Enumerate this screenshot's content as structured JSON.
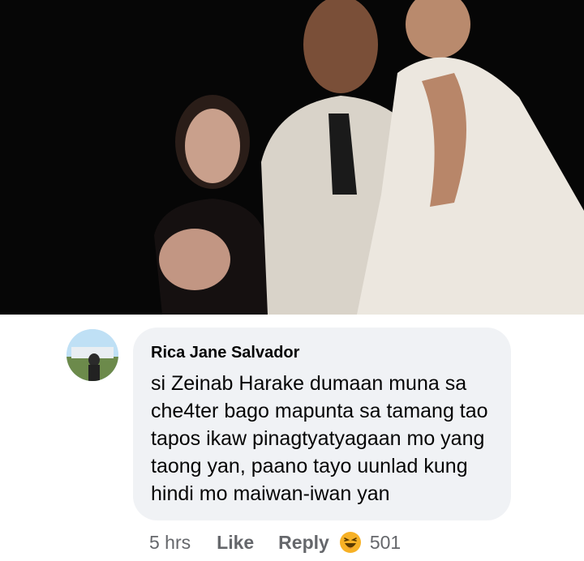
{
  "comment": {
    "author": "Rica Jane Salvador",
    "text": "si Zeinab Harake dumaan muna sa che4ter bago mapunta sa tamang tao tapos ikaw pinagtyatyagaan mo yang taong yan, paano tayo uunlad kung hindi mo maiwan-iwan yan",
    "time": "5 hrs",
    "like_label": "Like",
    "reply_label": "Reply",
    "reaction_icon": "haha-reaction-icon",
    "reaction_count": "501"
  },
  "colors": {
    "bubble": "#f0f2f5",
    "meta_text": "#65676b",
    "reaction_yellow": "#f7b125"
  }
}
